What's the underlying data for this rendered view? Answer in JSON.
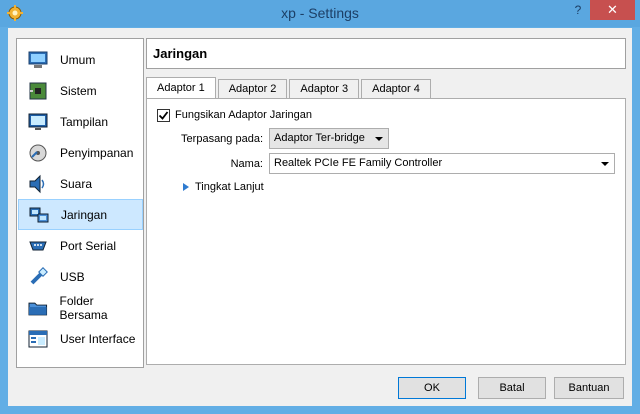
{
  "window": {
    "title": "xp - Settings",
    "help_glyph": "?",
    "close_glyph": "✕",
    "colors": {
      "titlebar": "#5aa7e0",
      "close": "#c7504f",
      "selection": "#cde8ff"
    }
  },
  "sidebar": {
    "items": [
      {
        "label": "Umum",
        "icon": "monitor-icon"
      },
      {
        "label": "Sistem",
        "icon": "chip-icon"
      },
      {
        "label": "Tampilan",
        "icon": "display-icon"
      },
      {
        "label": "Penyimpanan",
        "icon": "disk-icon"
      },
      {
        "label": "Suara",
        "icon": "speaker-icon"
      },
      {
        "label": "Jaringan",
        "icon": "network-icon",
        "selected": true
      },
      {
        "label": "Port Serial",
        "icon": "serial-port-icon"
      },
      {
        "label": "USB",
        "icon": "usb-icon"
      },
      {
        "label": "Folder Bersama",
        "icon": "folder-icon"
      },
      {
        "label": "User Interface",
        "icon": "ui-icon"
      }
    ]
  },
  "panel": {
    "title": "Jaringan",
    "tabs": [
      {
        "label": "Adaptor 1",
        "active": true
      },
      {
        "label": "Adaptor 2"
      },
      {
        "label": "Adaptor 3"
      },
      {
        "label": "Adaptor 4"
      }
    ],
    "enable_label": "Fungsikan Adaptor Jaringan",
    "enable_checked": true,
    "attached_label": "Terpasang pada:",
    "attached_value": "Adaptor Ter-bridge",
    "name_label": "Nama:",
    "name_value": "Realtek PCIe FE Family Controller",
    "advanced_label": "Tingkat Lanjut"
  },
  "buttons": {
    "ok": "OK",
    "cancel": "Batal",
    "help": "Bantuan"
  }
}
